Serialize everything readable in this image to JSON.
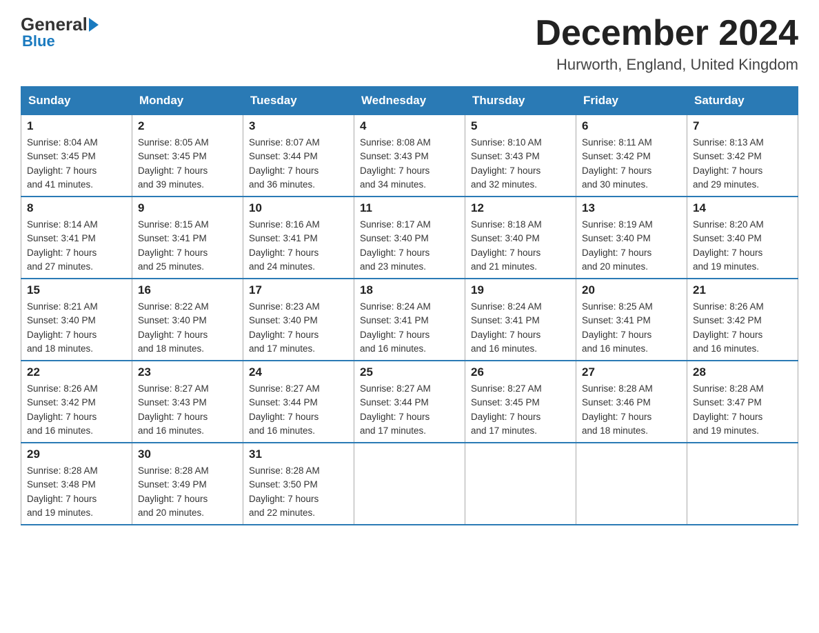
{
  "logo": {
    "general": "General",
    "blue": "Blue"
  },
  "header": {
    "month_title": "December 2024",
    "location": "Hurworth, England, United Kingdom"
  },
  "days_of_week": [
    "Sunday",
    "Monday",
    "Tuesday",
    "Wednesday",
    "Thursday",
    "Friday",
    "Saturday"
  ],
  "weeks": [
    [
      {
        "day": "1",
        "sunrise": "8:04 AM",
        "sunset": "3:45 PM",
        "daylight": "7 hours and 41 minutes."
      },
      {
        "day": "2",
        "sunrise": "8:05 AM",
        "sunset": "3:45 PM",
        "daylight": "7 hours and 39 minutes."
      },
      {
        "day": "3",
        "sunrise": "8:07 AM",
        "sunset": "3:44 PM",
        "daylight": "7 hours and 36 minutes."
      },
      {
        "day": "4",
        "sunrise": "8:08 AM",
        "sunset": "3:43 PM",
        "daylight": "7 hours and 34 minutes."
      },
      {
        "day": "5",
        "sunrise": "8:10 AM",
        "sunset": "3:43 PM",
        "daylight": "7 hours and 32 minutes."
      },
      {
        "day": "6",
        "sunrise": "8:11 AM",
        "sunset": "3:42 PM",
        "daylight": "7 hours and 30 minutes."
      },
      {
        "day": "7",
        "sunrise": "8:13 AM",
        "sunset": "3:42 PM",
        "daylight": "7 hours and 29 minutes."
      }
    ],
    [
      {
        "day": "8",
        "sunrise": "8:14 AM",
        "sunset": "3:41 PM",
        "daylight": "7 hours and 27 minutes."
      },
      {
        "day": "9",
        "sunrise": "8:15 AM",
        "sunset": "3:41 PM",
        "daylight": "7 hours and 25 minutes."
      },
      {
        "day": "10",
        "sunrise": "8:16 AM",
        "sunset": "3:41 PM",
        "daylight": "7 hours and 24 minutes."
      },
      {
        "day": "11",
        "sunrise": "8:17 AM",
        "sunset": "3:40 PM",
        "daylight": "7 hours and 23 minutes."
      },
      {
        "day": "12",
        "sunrise": "8:18 AM",
        "sunset": "3:40 PM",
        "daylight": "7 hours and 21 minutes."
      },
      {
        "day": "13",
        "sunrise": "8:19 AM",
        "sunset": "3:40 PM",
        "daylight": "7 hours and 20 minutes."
      },
      {
        "day": "14",
        "sunrise": "8:20 AM",
        "sunset": "3:40 PM",
        "daylight": "7 hours and 19 minutes."
      }
    ],
    [
      {
        "day": "15",
        "sunrise": "8:21 AM",
        "sunset": "3:40 PM",
        "daylight": "7 hours and 18 minutes."
      },
      {
        "day": "16",
        "sunrise": "8:22 AM",
        "sunset": "3:40 PM",
        "daylight": "7 hours and 18 minutes."
      },
      {
        "day": "17",
        "sunrise": "8:23 AM",
        "sunset": "3:40 PM",
        "daylight": "7 hours and 17 minutes."
      },
      {
        "day": "18",
        "sunrise": "8:24 AM",
        "sunset": "3:41 PM",
        "daylight": "7 hours and 16 minutes."
      },
      {
        "day": "19",
        "sunrise": "8:24 AM",
        "sunset": "3:41 PM",
        "daylight": "7 hours and 16 minutes."
      },
      {
        "day": "20",
        "sunrise": "8:25 AM",
        "sunset": "3:41 PM",
        "daylight": "7 hours and 16 minutes."
      },
      {
        "day": "21",
        "sunrise": "8:26 AM",
        "sunset": "3:42 PM",
        "daylight": "7 hours and 16 minutes."
      }
    ],
    [
      {
        "day": "22",
        "sunrise": "8:26 AM",
        "sunset": "3:42 PM",
        "daylight": "7 hours and 16 minutes."
      },
      {
        "day": "23",
        "sunrise": "8:27 AM",
        "sunset": "3:43 PM",
        "daylight": "7 hours and 16 minutes."
      },
      {
        "day": "24",
        "sunrise": "8:27 AM",
        "sunset": "3:44 PM",
        "daylight": "7 hours and 16 minutes."
      },
      {
        "day": "25",
        "sunrise": "8:27 AM",
        "sunset": "3:44 PM",
        "daylight": "7 hours and 17 minutes."
      },
      {
        "day": "26",
        "sunrise": "8:27 AM",
        "sunset": "3:45 PM",
        "daylight": "7 hours and 17 minutes."
      },
      {
        "day": "27",
        "sunrise": "8:28 AM",
        "sunset": "3:46 PM",
        "daylight": "7 hours and 18 minutes."
      },
      {
        "day": "28",
        "sunrise": "8:28 AM",
        "sunset": "3:47 PM",
        "daylight": "7 hours and 19 minutes."
      }
    ],
    [
      {
        "day": "29",
        "sunrise": "8:28 AM",
        "sunset": "3:48 PM",
        "daylight": "7 hours and 19 minutes."
      },
      {
        "day": "30",
        "sunrise": "8:28 AM",
        "sunset": "3:49 PM",
        "daylight": "7 hours and 20 minutes."
      },
      {
        "day": "31",
        "sunrise": "8:28 AM",
        "sunset": "3:50 PM",
        "daylight": "7 hours and 22 minutes."
      },
      null,
      null,
      null,
      null
    ]
  ],
  "labels": {
    "sunrise": "Sunrise:",
    "sunset": "Sunset:",
    "daylight": "Daylight:"
  }
}
